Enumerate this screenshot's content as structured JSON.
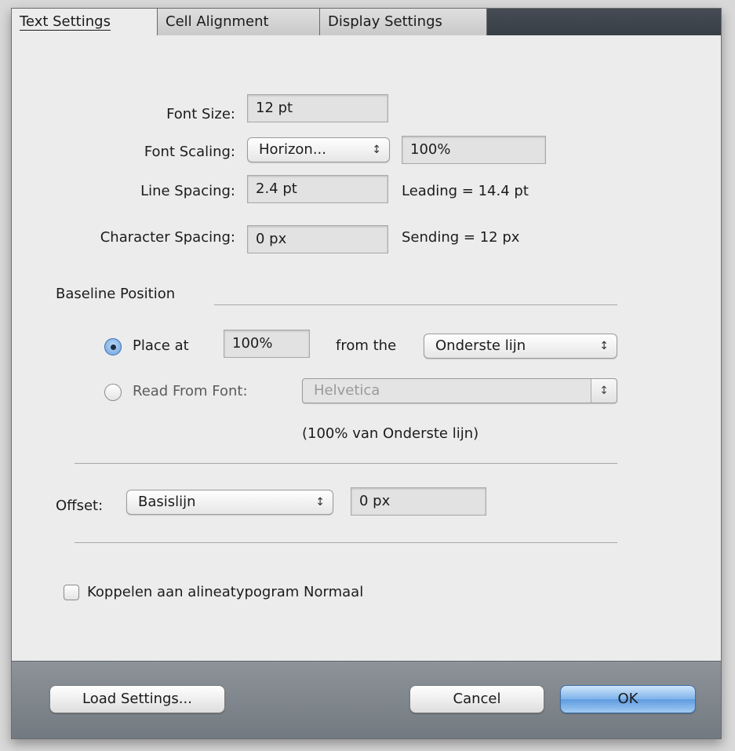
{
  "tabs": [
    {
      "label": "Text Settings",
      "active": true
    },
    {
      "label": "Cell Alignment",
      "active": false
    },
    {
      "label": "Display Settings",
      "active": false
    }
  ],
  "form": {
    "font_size_label": "Font Size:",
    "font_size_value": "12 pt",
    "font_scaling_label": "Font Scaling:",
    "font_scaling_popup": "Horizon...",
    "font_scaling_value": "100%",
    "line_spacing_label": "Line Spacing:",
    "line_spacing_value": "2.4 pt",
    "leading_text": "Leading = 14.4 pt",
    "character_spacing_label": "Character Spacing:",
    "character_spacing_value": "0 px",
    "sending_text": "Sending = 12 px"
  },
  "baseline": {
    "section_label": "Baseline Position",
    "place_at_label": "Place at",
    "place_at_value": "100%",
    "from_the_label": "from the",
    "from_the_popup": "Onderste lijn",
    "read_from_font_label": "Read From Font:",
    "font_popup": "Helvetica",
    "font_hint": "(100% van Onderste lijn)",
    "selected": "place_at"
  },
  "offset": {
    "label": "Offset:",
    "popup": "Basislijn",
    "value": "0 px"
  },
  "link_checkbox": {
    "label": "Koppelen aan alineatypogram Normaal",
    "checked": false
  },
  "footer": {
    "load_label": "Load Settings...",
    "cancel_label": "Cancel",
    "ok_label": "OK"
  },
  "icons": {
    "popup_arrows": "updown-arrows-icon"
  },
  "colors": {
    "tabbar": "#3f454c",
    "footer": "#80868c",
    "default_button": "#6aa2e4"
  }
}
